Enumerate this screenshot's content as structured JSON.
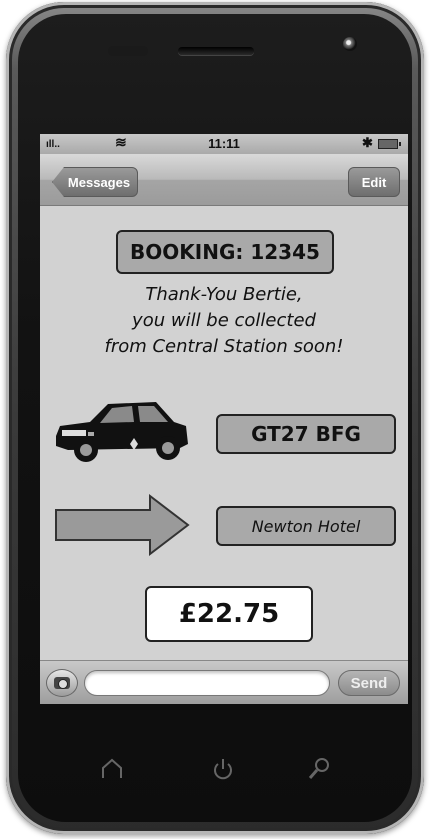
{
  "status_bar": {
    "time": "11:11",
    "signal": "ıll..",
    "wifi": "≋",
    "bluetooth": "✱"
  },
  "nav": {
    "back_label": "Messages",
    "edit_label": "Edit"
  },
  "booking": {
    "label": "BOOKING: 12345"
  },
  "message": {
    "line1": "Thank-You Bertie,",
    "line2": "you will be collected",
    "line3": "from Central Station soon!"
  },
  "vehicle": {
    "plate": "GT27 BFG",
    "icon": "car-icon"
  },
  "destination": {
    "label": "Newton Hotel",
    "icon": "arrow-right-icon"
  },
  "fare": {
    "price": "£22.75"
  },
  "composer": {
    "placeholder": "",
    "send_label": "Send"
  },
  "hardware_buttons": [
    "home-icon",
    "power-icon",
    "search-icon"
  ],
  "colors": {
    "screen_bg": "#d2d2d2",
    "box_fill": "#a9a9a9",
    "price_fill": "#ffffff"
  }
}
